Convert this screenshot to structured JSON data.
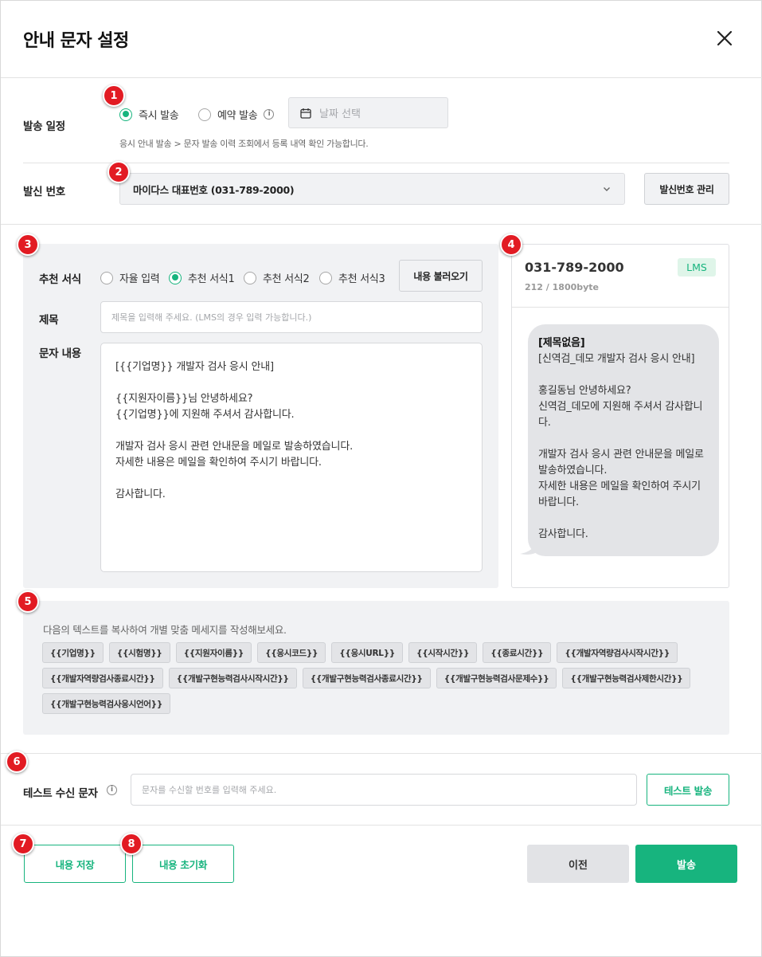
{
  "dialog": {
    "title": "안내 문자 설정"
  },
  "schedule": {
    "label": "발송 일정",
    "options": [
      {
        "label": "즉시 발송",
        "selected": true
      },
      {
        "label": "예약 발송",
        "selected": false
      }
    ],
    "date_placeholder": "날짜 선택",
    "hint": "응시 안내 발송 > 문자 발송 이력 조회에서 등록 내역 확인 가능합니다."
  },
  "sender": {
    "label": "발신 번호",
    "selected": "마이다스 대표번호 (031-789-2000)",
    "manage_button": "발신번호 관리"
  },
  "template": {
    "label": "추천 서식",
    "options": [
      {
        "label": "자율 입력",
        "selected": false
      },
      {
        "label": "추천 서식1",
        "selected": true
      },
      {
        "label": "추천 서식2",
        "selected": false
      },
      {
        "label": "추천 서식3",
        "selected": false
      }
    ],
    "load_button": "내용 불러오기"
  },
  "subject": {
    "label": "제목",
    "placeholder": "제목을 입력해 주세요. (LMS의 경우 입력 가능합니다.)"
  },
  "body": {
    "label": "문자 내용",
    "lines": [
      "[{{기업명}} 개발자 검사 응시 안내]",
      "",
      "{{지원자이름}}님 안녕하세요?",
      "{{기업명}}에 지원해 주셔서 감사합니다.",
      "",
      "개발자 검사 응시 관련 안내문을 메일로 발송하였습니다.",
      "자세한 내용은 메일을 확인하여 주시기 바랍니다.",
      "",
      "감사합니다."
    ]
  },
  "preview": {
    "number": "031-789-2000",
    "bytes": "212 / 1800byte",
    "type_badge": "LMS",
    "subject": "[제목없음]",
    "lines": [
      "[신역검_데모 개발자 검사 응시 안내]",
      "",
      "홍길동님 안녕하세요?",
      "신역검_데모에 지원해 주셔서 감사합니",
      "다.",
      "",
      "개발자 검사 응시 관련 안내문을 메일로",
      "발송하였습니다.",
      "자세한 내용은 메일을 확인하여 주시기",
      "바랍니다.",
      "",
      "감사합니다."
    ]
  },
  "variables": {
    "description": "다음의 텍스트를 복사하여 개별 맞춤 메세지를 작성해보세요.",
    "tags": [
      "{{기업명}}",
      "{{시험명}}",
      "{{지원자이름}}",
      "{{응시코드}}",
      "{{응시URL}}",
      "{{시작시간}}",
      "{{종료시간}}",
      "{{개발자역량검사시작시간}}",
      "{{개발자역량검사종료시간}}",
      "{{개발구현능력검사시작시간}}",
      "{{개발구현능력검사종료시간}}",
      "{{개발구현능력검사문제수}}",
      "{{개발구현능력검사제한시간}}",
      "{{개발구현능력검사응시언어}}"
    ]
  },
  "test": {
    "label": "테스트 수신 문자",
    "placeholder": "문자를 수신할 번호를 입력해 주세요.",
    "send_button": "테스트 발송"
  },
  "footer": {
    "save": "내용 저장",
    "reset": "내용 초기화",
    "prev": "이전",
    "send": "발송"
  },
  "badges": [
    "1",
    "2",
    "3",
    "4",
    "5",
    "6",
    "7",
    "8"
  ],
  "colors": {
    "accent": "#17b47e",
    "badge": "#e21b23",
    "panel_bg": "#f1f2f4"
  }
}
